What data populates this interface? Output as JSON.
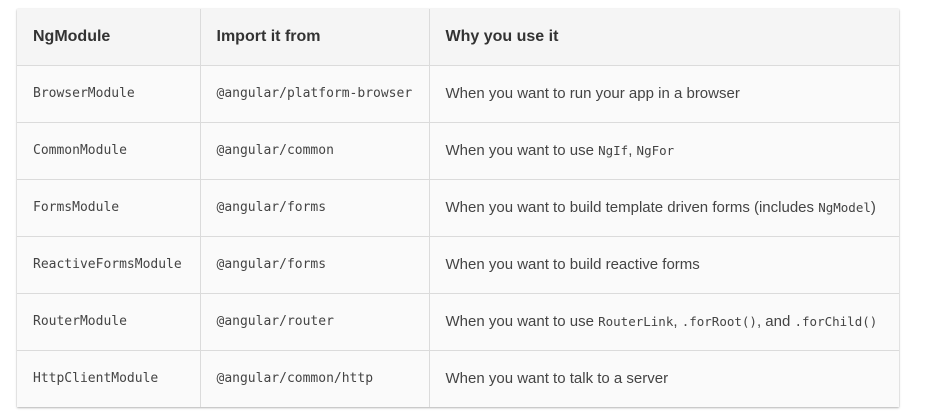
{
  "table": {
    "headers": [
      "NgModule",
      "Import it from",
      "Why you use it"
    ],
    "rows": [
      {
        "module": "BrowserModule",
        "import_from": "@angular/platform-browser",
        "why": [
          {
            "text": "When you want to run your app in a browser",
            "code": false
          }
        ]
      },
      {
        "module": "CommonModule",
        "import_from": "@angular/common",
        "why": [
          {
            "text": "When you want to use ",
            "code": false
          },
          {
            "text": "NgIf",
            "code": true
          },
          {
            "text": ", ",
            "code": false
          },
          {
            "text": "NgFor",
            "code": true
          }
        ]
      },
      {
        "module": "FormsModule",
        "import_from": "@angular/forms",
        "why": [
          {
            "text": "When you want to build template driven forms (includes ",
            "code": false
          },
          {
            "text": "NgModel",
            "code": true
          },
          {
            "text": ")",
            "code": false
          }
        ]
      },
      {
        "module": "ReactiveFormsModule",
        "import_from": "@angular/forms",
        "why": [
          {
            "text": "When you want to build reactive forms",
            "code": false
          }
        ]
      },
      {
        "module": "RouterModule",
        "import_from": "@angular/router",
        "why": [
          {
            "text": "When you want to use ",
            "code": false
          },
          {
            "text": "RouterLink",
            "code": true
          },
          {
            "text": ", ",
            "code": false
          },
          {
            "text": ".forRoot()",
            "code": true
          },
          {
            "text": ", and ",
            "code": false
          },
          {
            "text": ".forChild()",
            "code": true
          }
        ]
      },
      {
        "module": "HttpClientModule",
        "import_from": "@angular/common/http",
        "why": [
          {
            "text": "When you want to talk to a server",
            "code": false
          }
        ]
      }
    ]
  }
}
